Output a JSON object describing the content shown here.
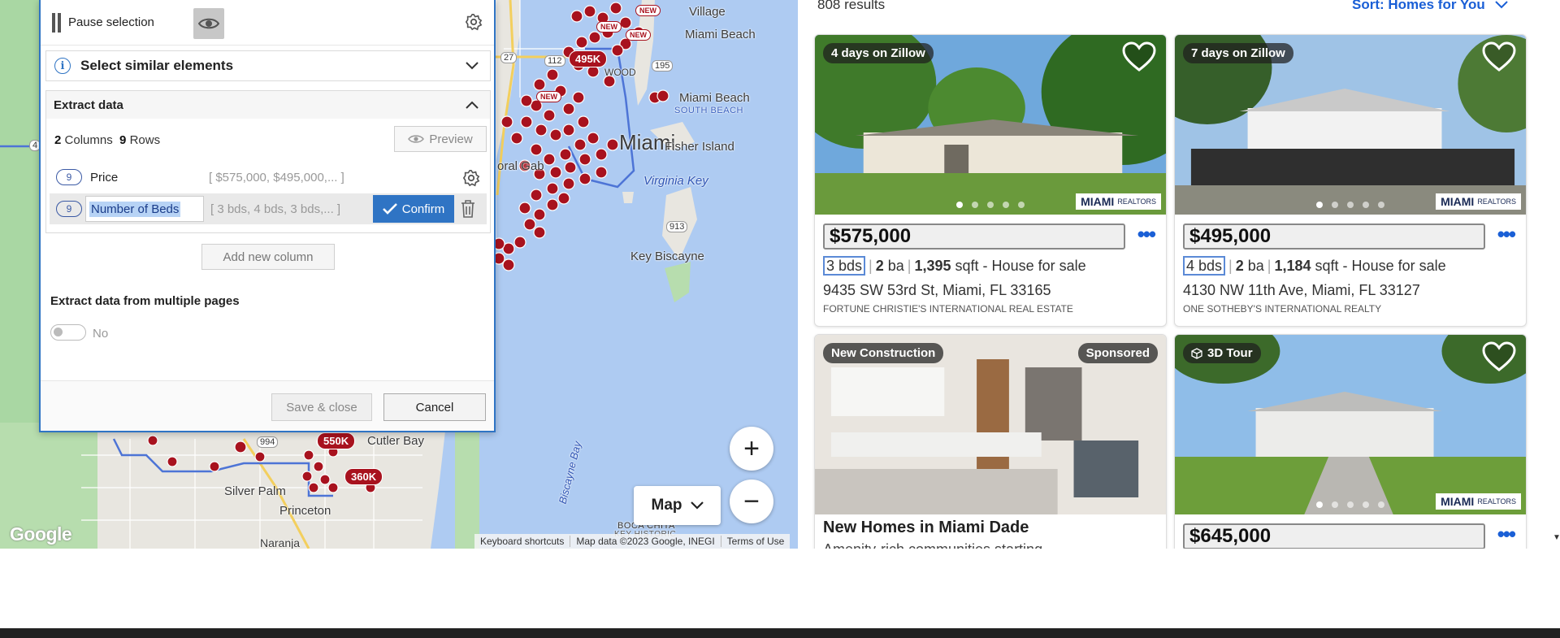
{
  "map": {
    "labels": {
      "village": "Village",
      "miami_beach_n": "Miami Beach",
      "miami_beach": "Miami Beach",
      "south_beach": "SOUTH BEACH",
      "miami": "Miami",
      "fisher_island": "Fisher Island",
      "virginia_key": "Virginia Key",
      "key_biscayne": "Key Biscayne",
      "coral_gables": "oral Gab",
      "cutler_bay": "Cutler Bay",
      "silver_palm": "Silver Palm",
      "princeton": "Princeton",
      "naranja": "Naranja",
      "biscayne_bay": "Biscayne Bay",
      "boca_chita": "BOCA CHITA",
      "key_historic": "KEY HISTORIC",
      "nwood": "WOOD",
      "route_913": "913",
      "route_994": "994",
      "route_27": "27",
      "route_112": "112",
      "route_195": "195",
      "route_4": "4"
    },
    "pills": {
      "p495": "495K",
      "p550": "550K",
      "p360": "360K",
      "new": "NEW"
    },
    "map_type": "Map",
    "zoom_in": "+",
    "zoom_out": "−",
    "google": "Google",
    "attribution": {
      "shortcuts": "Keyboard shortcuts",
      "data": "Map data ©2023 Google, INEGI",
      "terms": "Terms of Use"
    }
  },
  "panel": {
    "pause_label": "Pause selection",
    "similar_label": "Select similar elements",
    "extract_title": "Extract data",
    "columns_count": "2",
    "columns_word": "Columns",
    "rows_count": "9",
    "rows_word": "Rows",
    "preview_label": "Preview",
    "columns": [
      {
        "count": "9",
        "name": "Price",
        "preview": "[ $575,000, $495,000,... ]"
      },
      {
        "count": "9",
        "name": "Number of Beds",
        "preview": "[ 3 bds, 4 bds, 3 bds,... ]"
      }
    ],
    "confirm_label": "Confirm",
    "add_column_label": "Add new column",
    "multi_pages_label": "Extract data from multiple pages",
    "toggle_label": "No",
    "save_close_label": "Save & close",
    "cancel_label": "Cancel"
  },
  "listings": {
    "results": "808 results",
    "sort": "Sort: Homes for You",
    "cards": [
      {
        "tag": "4 days on Zillow",
        "price": "$575,000",
        "beds": "3 bds",
        "baths": "2",
        "baths_unit": "ba",
        "sqft": "1,395",
        "sqft_unit": "sqft - House for sale",
        "address": "9435 SW 53rd St, Miami, FL 33165",
        "broker": "FORTUNE CHRISTIE'S INTERNATIONAL REAL ESTATE"
      },
      {
        "tag": "7 days on Zillow",
        "price": "$495,000",
        "beds": "4 bds",
        "baths": "2",
        "baths_unit": "ba",
        "sqft": "1,184",
        "sqft_unit": "sqft - House for sale",
        "address": "4130 NW 11th Ave, Miami, FL 33127",
        "broker": "ONE SOTHEBY'S INTERNATIONAL REALTY"
      },
      {
        "tag": "New Construction",
        "tag_right": "Sponsored",
        "title": "New Homes in Miami Dade",
        "subtitle": "Amenity-rich communities starting"
      },
      {
        "tag": "3D Tour",
        "price": "$645,000"
      }
    ],
    "brand": "MIAMI",
    "brand_small": "REALTORS",
    "more": "•••"
  },
  "colors": {
    "accent": "#2f74c4",
    "pin": "#a8121e",
    "link": "#1a5fd6"
  }
}
